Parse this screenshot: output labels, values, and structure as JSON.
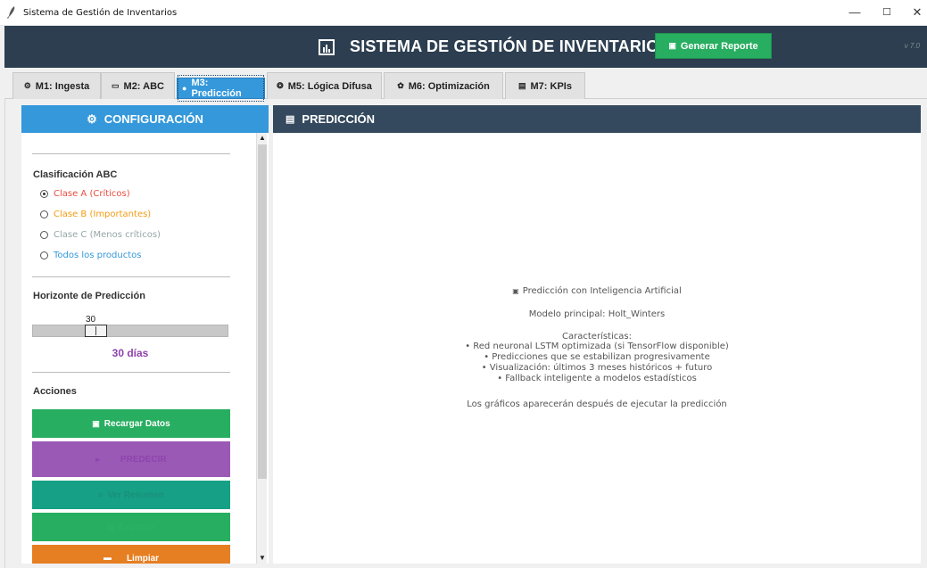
{
  "window": {
    "title": "Sistema de Gestión de Inventarios",
    "controls": {
      "minimize": "—",
      "maximize": "☐",
      "close": "✕"
    }
  },
  "header": {
    "title": "SISTEMA DE GESTIÓN DE INVENTARIOS",
    "report_button": "Generar Reporte",
    "version": "v 7.0",
    "colors": {
      "background": "#2c3e50",
      "report": "#27ae60"
    }
  },
  "tabs": [
    {
      "label": "M1: Ingesta",
      "icon": "gear-icon",
      "active": false
    },
    {
      "label": "M2: ABC",
      "icon": "folder-icon",
      "active": false
    },
    {
      "label": "M3: Predicción",
      "icon": "crystal-ball-icon",
      "active": true
    },
    {
      "label": "M5: Lógica Difusa",
      "icon": "brain-icon",
      "active": false
    },
    {
      "label": "M6: Optimización",
      "icon": "settings-icon",
      "active": false
    },
    {
      "label": "M7: KPIs",
      "icon": "chart-icon",
      "active": false
    }
  ],
  "config": {
    "title": "CONFIGURACIÓN",
    "abc": {
      "title": "Clasificación ABC",
      "selected_index": 0,
      "options": [
        {
          "label": "Clase A (Críticos)",
          "color": "#e74c3c"
        },
        {
          "label": "Clase B (Importantes)",
          "color": "#f39c12"
        },
        {
          "label": "Clase C (Menos críticos)",
          "color": "#95a5a6"
        },
        {
          "label": "Todos los productos",
          "color": "#3498db"
        }
      ]
    },
    "horizon": {
      "title": "Horizonte de Predicción",
      "value": "30",
      "fraction": 0.3,
      "label": "30 días"
    },
    "actions": {
      "title": "Acciones",
      "buttons": [
        {
          "label": "Recargar Datos",
          "color": "#27ae60",
          "text_color": "#ffffff"
        },
        {
          "label": "PREDECIR",
          "color": "#9b59b6",
          "text_color": "#8e44ad"
        },
        {
          "label": "Ver Resumen",
          "color": "#16a085",
          "text_color": "#1a8f7a"
        },
        {
          "label": "Exportar",
          "color": "#27ae60",
          "text_color": "#2eb066"
        },
        {
          "label": "Limpiar",
          "color": "#e67e22",
          "text_color": "#ffffff"
        }
      ]
    }
  },
  "prediction": {
    "title": "PREDICCIÓN",
    "heading": "Predicción con Inteligencia Artificial",
    "model": "Modelo principal: Holt_Winters",
    "features_title": "Características:",
    "features": [
      "• Red neuronal LSTM optimizada (si TensorFlow disponible)",
      "• Predicciones que se estabilizan progresivamente",
      "• Visualización: últimos 3 meses históricos + futuro",
      "• Fallback inteligente a modelos estadísticos"
    ],
    "footer": "Los gráficos aparecerán después de ejecutar la predicción"
  }
}
